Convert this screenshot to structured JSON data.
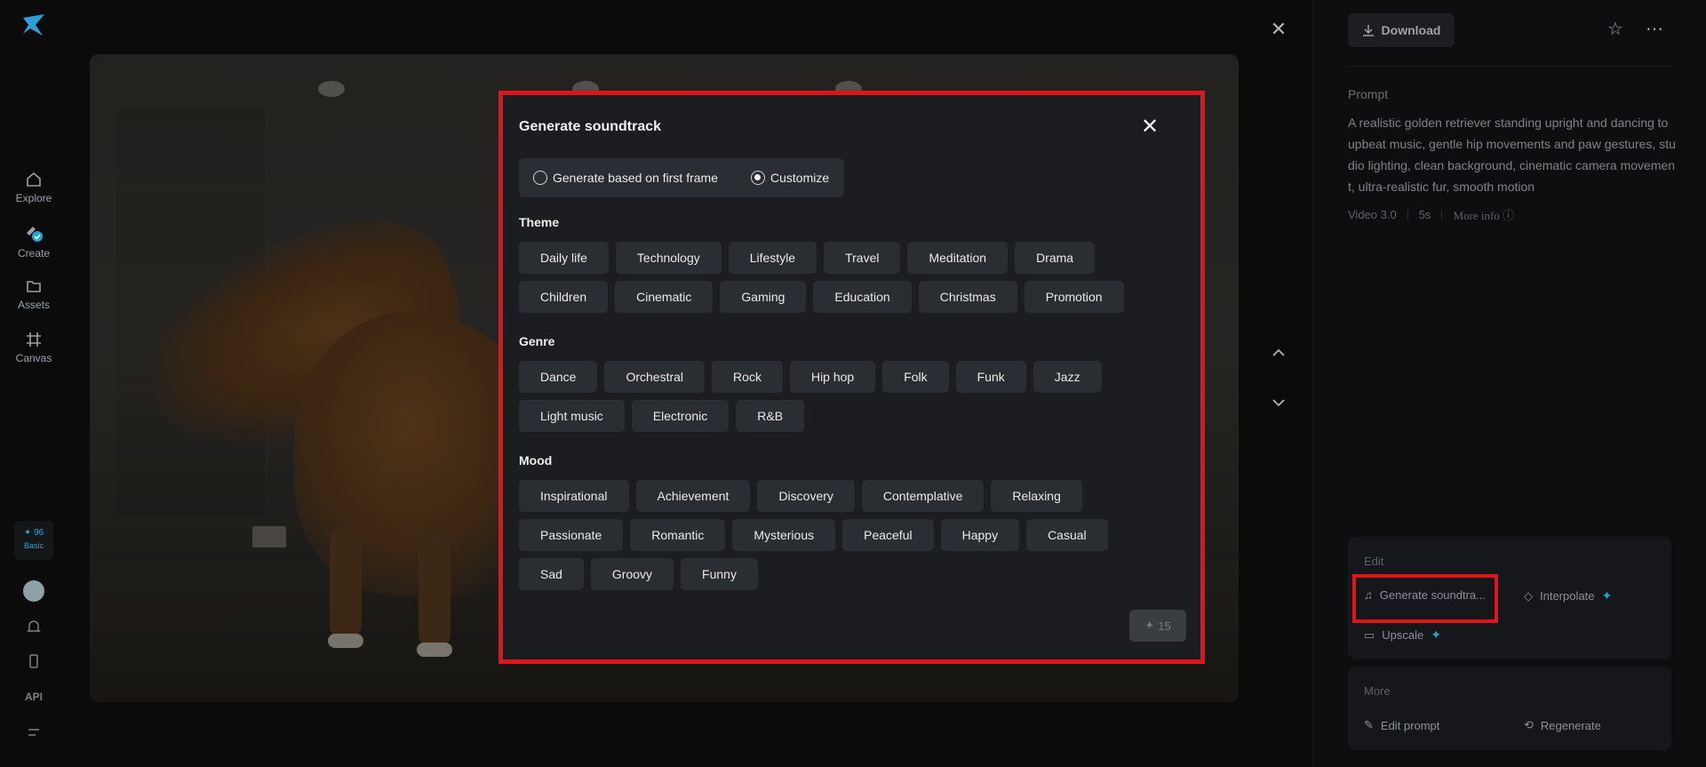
{
  "nav": {
    "items": [
      {
        "label": "Explore"
      },
      {
        "label": "Create"
      },
      {
        "label": "Assets"
      },
      {
        "label": "Canvas"
      }
    ],
    "credits": {
      "amount": "96",
      "plan": "Basic"
    },
    "api_label": "API"
  },
  "viewer": {
    "close_icon": "close-icon",
    "up_icon": "chevron-up-icon",
    "down_icon": "chevron-down-icon"
  },
  "right_panel": {
    "download_label": "Download",
    "prompt_label": "Prompt",
    "prompt_text": "A realistic golden retriever standing upright and dancing to upbeat music, gentle hip movements and paw gestures, studio lighting, clean background, cinematic camera movement, ultra-realistic fur, smooth motion",
    "meta": {
      "model": "Video 3.0",
      "duration": "5s",
      "more_info": "More info"
    },
    "edit": {
      "label": "Edit",
      "generate_soundtrack": "Generate soundtra...",
      "interpolate": "Interpolate",
      "upscale": "Upscale"
    },
    "more": {
      "label": "More",
      "edit_prompt": "Edit prompt",
      "regenerate": "Regenerate"
    }
  },
  "modal": {
    "title": "Generate soundtrack",
    "options": {
      "first_frame": "Generate based on first frame",
      "customize": "Customize",
      "selected": "customize"
    },
    "theme": {
      "title": "Theme",
      "chips": [
        "Daily life",
        "Technology",
        "Lifestyle",
        "Travel",
        "Meditation",
        "Drama",
        "Children",
        "Cinematic",
        "Gaming",
        "Education",
        "Christmas",
        "Promotion"
      ]
    },
    "genre": {
      "title": "Genre",
      "chips": [
        "Dance",
        "Orchestral",
        "Rock",
        "Hip hop",
        "Folk",
        "Funk",
        "Jazz",
        "Light music",
        "Electronic",
        "R&B"
      ]
    },
    "mood": {
      "title": "Mood",
      "chips": [
        "Inspirational",
        "Achievement",
        "Discovery",
        "Contemplative",
        "Relaxing",
        "Passionate",
        "Romantic",
        "Mysterious",
        "Peaceful",
        "Happy",
        "Casual",
        "Sad",
        "Groovy",
        "Funny"
      ]
    },
    "generate_cost": "15"
  },
  "colors": {
    "accent": "#1ea7d6",
    "highlight": "#e0151b"
  }
}
